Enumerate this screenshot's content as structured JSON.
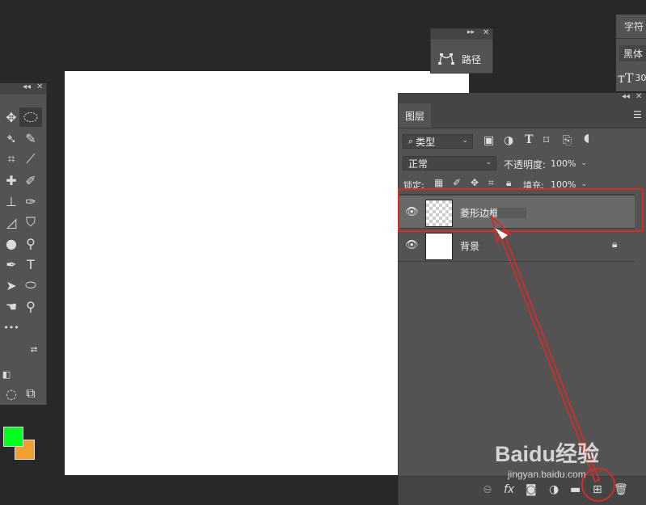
{
  "toolbar": {
    "collapse": "◂◂",
    "close": "✕",
    "more": "•••"
  },
  "paths_panel": {
    "label": "路径",
    "expand": "▸▸",
    "close": "✕"
  },
  "character_panel": {
    "tab": "字符",
    "font": "黑体",
    "size": "30"
  },
  "layers_panel": {
    "tab": "图层",
    "collapse": "◂◂",
    "close": "✕",
    "menu": "☰",
    "filter_kind": "类型",
    "blend_mode": "正常",
    "opacity_label": "不透明度:",
    "opacity_value": "100%",
    "lock_label": "锁定:",
    "fill_label": "填充:",
    "fill_value": "100%",
    "layers": [
      {
        "name": "菱形边框",
        "visible": true,
        "selected": true,
        "transparent": true
      },
      {
        "name": "背景",
        "visible": true,
        "selected": false,
        "locked": true
      }
    ]
  },
  "colors": {
    "foreground": "#00ff1e",
    "background": "#f0a030",
    "annotation": "#d42b2b"
  },
  "watermark": {
    "brand": "Baidu经验",
    "url": "jingyan.baidu.com"
  }
}
